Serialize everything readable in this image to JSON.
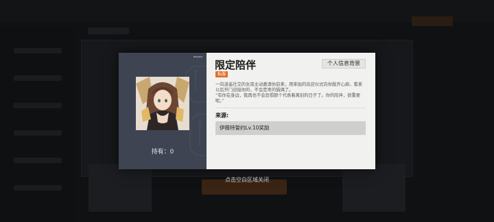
{
  "modal": {
    "title": "限定陪伴",
    "profile_button": "个人信息背景",
    "rarity_tag": "私服",
    "description": [
      "一向逍遥社交的女孩主动邀请你前来，用笨拙的欢迎仪式向你敞开心扉。看来以后开门迎接你的，不会是卑的猫偶了。",
      "“有你在身边，我再也不会恐惧那个代表着离别的日子了。你的陪伴，很重要呢。”"
    ],
    "source_label": "来源:",
    "source_value": "伊薇特誓约Lv.10奖励",
    "held_label": "持有：",
    "held_count": "0"
  },
  "close_hint": "点击空白区域关闭",
  "colors": {
    "rarity": "#e36e2c",
    "left_panel": "#3e4452",
    "right_panel": "#f1f1ef"
  }
}
